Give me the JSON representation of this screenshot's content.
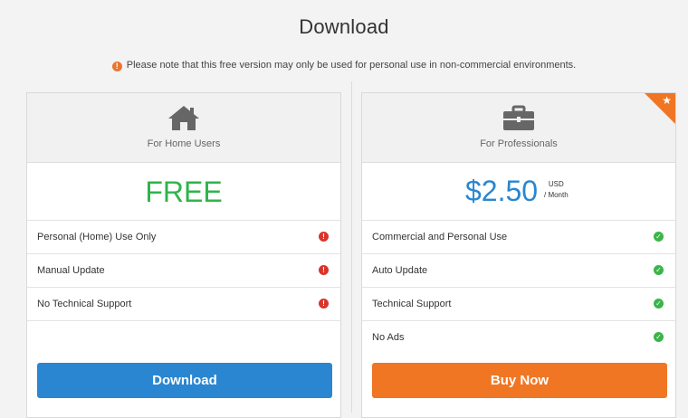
{
  "page": {
    "title": "Download",
    "notice": "Please note that this free version may only be used for personal use in non-commercial environments.",
    "notice_icon": "!"
  },
  "plans": {
    "home": {
      "name": "For Home Users",
      "icon": "house-icon",
      "price": "FREE",
      "features": [
        {
          "label": "Personal (Home) Use Only",
          "status": "!"
        },
        {
          "label": "Manual Update",
          "status": "!"
        },
        {
          "label": "No Technical Support",
          "status": "!"
        }
      ],
      "button_label": "Download",
      "accent": "#2a86d1"
    },
    "pro": {
      "name": "For Professionals",
      "icon": "briefcase-icon",
      "price": "$2.50",
      "currency": "USD",
      "period": "/ Month",
      "badge_icon": "star-icon",
      "features": [
        {
          "label": "Commercial and Personal Use",
          "status": "✓"
        },
        {
          "label": "Auto Update",
          "status": "✓"
        },
        {
          "label": "Technical Support",
          "status": "✓"
        },
        {
          "label": "No Ads",
          "status": "✓"
        }
      ],
      "button_label": "Buy Now",
      "accent": "#f07623"
    }
  },
  "colors": {
    "free_green": "#2fb44b",
    "price_blue": "#2a86d1",
    "warning_red": "#d9342b",
    "check_green": "#3bb54a",
    "notice_orange": "#e8772e"
  }
}
